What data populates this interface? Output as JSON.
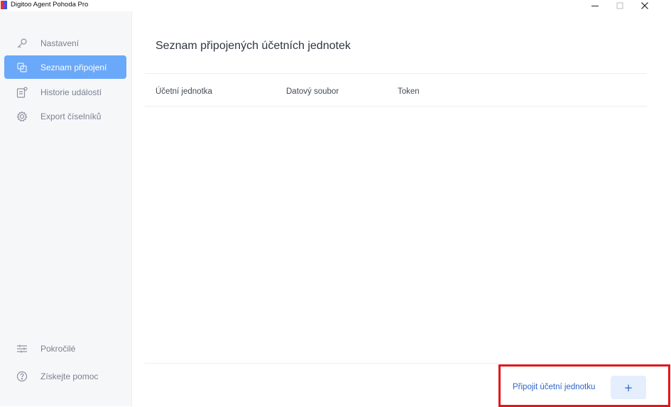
{
  "window": {
    "title": "Digitoo Agent Pohoda Pro",
    "controls": {
      "minimize": "–",
      "maximize": "□",
      "close": "✕"
    }
  },
  "sidebar": {
    "items": [
      {
        "label": "Nastavení",
        "icon": "key-icon",
        "active": false
      },
      {
        "label": "Seznam připojení",
        "icon": "stack-icon",
        "active": true
      },
      {
        "label": "Historie událostí",
        "icon": "history-icon",
        "active": false
      },
      {
        "label": "Export číselníků",
        "icon": "gear-icon",
        "active": false
      }
    ],
    "bottom_items": [
      {
        "label": "Pokročilé",
        "icon": "sliders-icon"
      },
      {
        "label": "Získejte pomoc",
        "icon": "help-icon"
      }
    ]
  },
  "main": {
    "title": "Seznam připojených účetních jednotek",
    "columns": [
      "Účetní jednotka",
      "Datový soubor",
      "Token"
    ],
    "rows": [],
    "connect_label": "Připojit účetní jednotku",
    "add_button_label": "+"
  },
  "colors": {
    "accent": "#6aa8f9",
    "link": "#2e64c9",
    "highlight": "#e0161b"
  }
}
